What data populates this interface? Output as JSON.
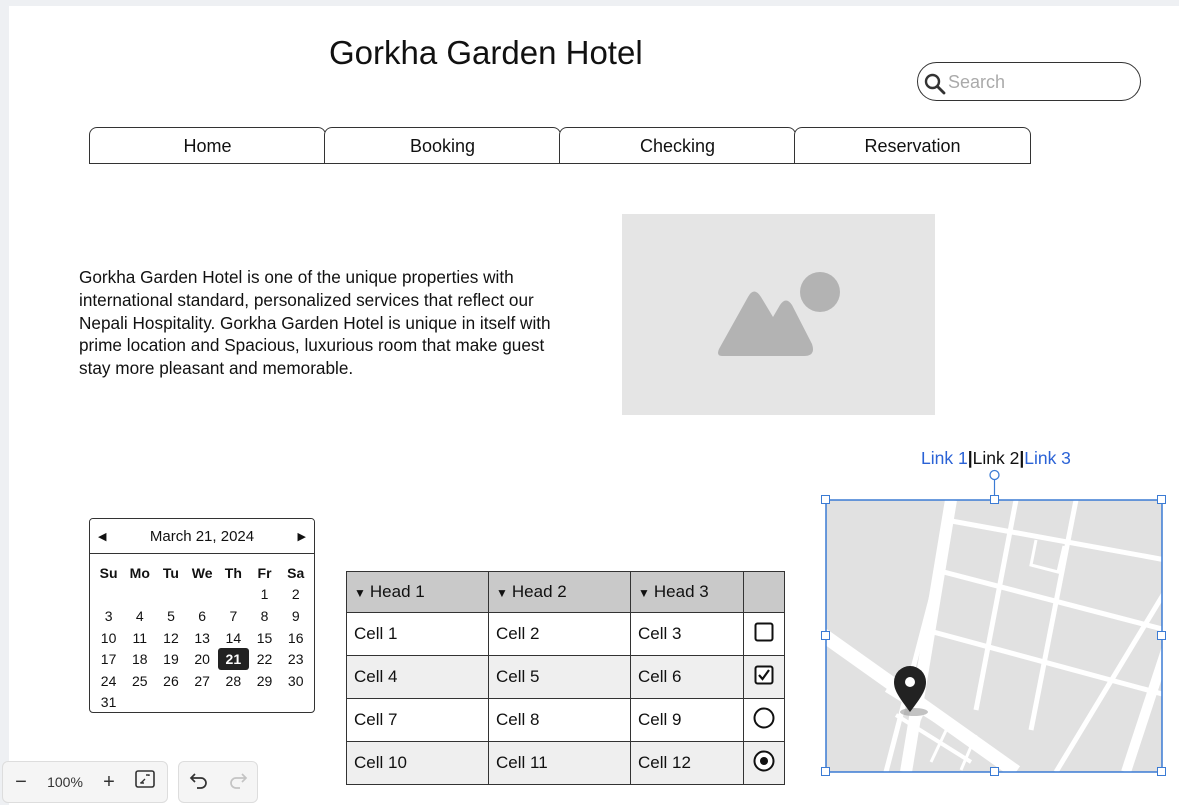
{
  "header": {
    "title": "Gorkha Garden Hotel"
  },
  "search": {
    "placeholder": "Search",
    "value": ""
  },
  "nav": {
    "tabs": [
      {
        "label": "Home"
      },
      {
        "label": "Booking"
      },
      {
        "label": "Checking"
      },
      {
        "label": "Reservation"
      }
    ]
  },
  "intro": {
    "text": "Gorkha Garden Hotel is one of the unique properties with international standard, personalized services that reflect our Nepali Hospitality. Gorkha Garden Hotel is unique in itself with prime location and Spacious, luxurious room that make guest stay more pleasant and memorable."
  },
  "links": [
    {
      "label": "Link 1"
    },
    {
      "label": "Link 2"
    },
    {
      "label": "Link 3"
    }
  ],
  "link_separator": "|",
  "calendar": {
    "month_label": "March 21, 2024",
    "weekdays": [
      "Su",
      "Mo",
      "Tu",
      "We",
      "Th",
      "Fr",
      "Sa"
    ],
    "days": [
      [
        "",
        "",
        "",
        "",
        "",
        "1",
        "2"
      ],
      [
        "3",
        "4",
        "5",
        "6",
        "7",
        "8",
        "9"
      ],
      [
        "10",
        "11",
        "12",
        "13",
        "14",
        "15",
        "16"
      ],
      [
        "17",
        "18",
        "19",
        "20",
        "21",
        "22",
        "23"
      ],
      [
        "24",
        "25",
        "26",
        "27",
        "28",
        "29",
        "30"
      ],
      [
        "31",
        "",
        "",
        "",
        "",
        "",
        ""
      ]
    ],
    "selected_day": "21"
  },
  "table": {
    "headers": [
      "Head 1",
      "Head 2",
      "Head 3"
    ],
    "rows": [
      {
        "cells": [
          "Cell 1",
          "Cell 2",
          "Cell 3"
        ],
        "control": "checkbox-unchecked"
      },
      {
        "cells": [
          "Cell 4",
          "Cell 5",
          "Cell 6"
        ],
        "control": "checkbox-checked"
      },
      {
        "cells": [
          "Cell 7",
          "Cell 8",
          "Cell 9"
        ],
        "control": "radio-unselected"
      },
      {
        "cells": [
          "Cell 10",
          "Cell 11",
          "Cell 12"
        ],
        "control": "radio-selected"
      }
    ]
  },
  "toolbar": {
    "zoom": "100%",
    "zoom_out_icon": "minus-icon",
    "zoom_in_icon": "plus-icon",
    "fit_icon": "fit-screen-icon",
    "undo_icon": "undo-icon",
    "redo_icon": "redo-icon"
  },
  "colors": {
    "link": "#2a62d6",
    "selection": "#3b7bd4",
    "placeholder_bg": "#e5e5e5",
    "table_header_bg": "#c9c9c9"
  }
}
